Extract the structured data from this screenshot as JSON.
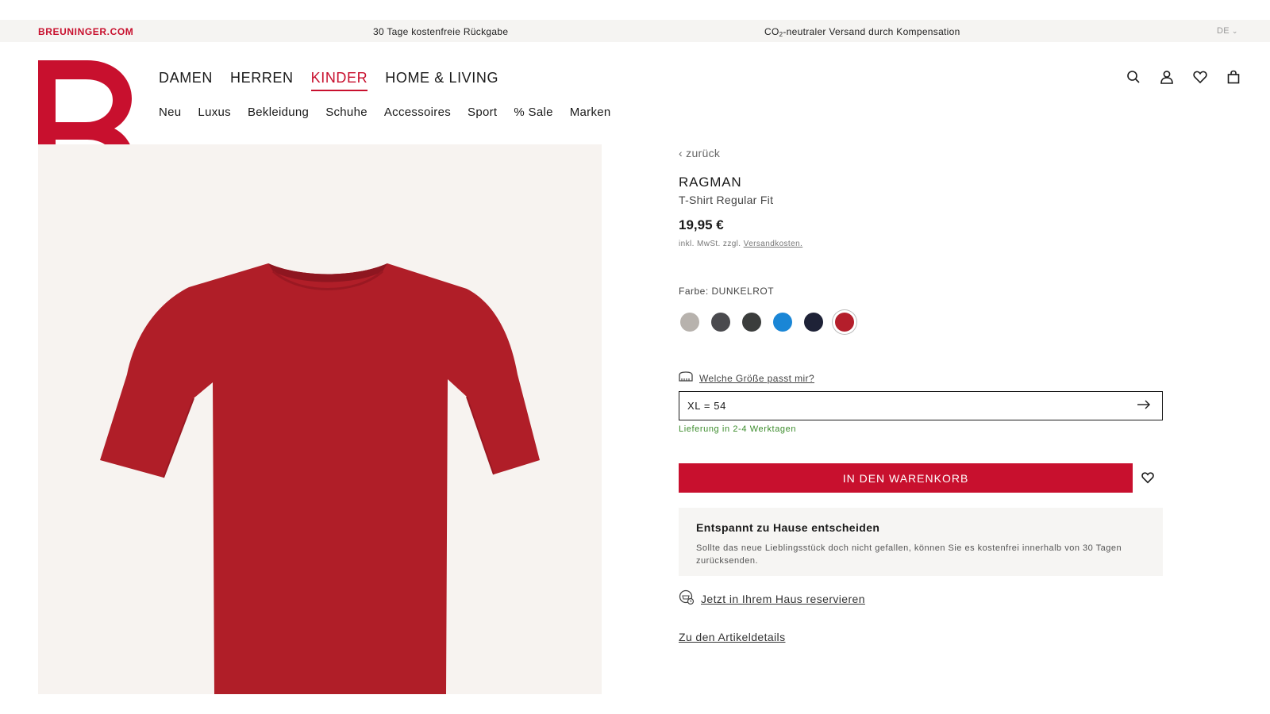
{
  "topbar": {
    "brand": "BREUNINGER.COM",
    "message_returns": "30 Tage kostenfreie Rückgabe",
    "message_shipping_pre": "CO",
    "message_shipping_sub": "2",
    "message_shipping_post": "-neutraler Versand durch Kompensation",
    "language": "DE"
  },
  "nav": {
    "main": [
      "DAMEN",
      "HERREN",
      "KINDER",
      "HOME & LIVING"
    ],
    "active": "KINDER",
    "sub": [
      "Neu",
      "Luxus",
      "Bekleidung",
      "Schuhe",
      "Accessoires",
      "Sport",
      "% Sale",
      "Marken"
    ]
  },
  "header_icons": [
    "search-icon",
    "user-icon",
    "heart-icon",
    "bag-icon"
  ],
  "product": {
    "back_label": "zurück",
    "brand": "RAGMAN",
    "name": "T-Shirt Regular Fit",
    "price": "19,95 €",
    "tax_note_prefix": "inkl. MwSt. zzgl.",
    "tax_note_link": "Versandkosten.",
    "color_label": "Farbe: DUNKELROT",
    "colors": [
      "#b7b2ad",
      "#4a4a4e",
      "#3b3d3c",
      "#1a86d6",
      "#1e2237",
      "#b41e2b"
    ],
    "selected_color_index": 5,
    "size_help_label": "Welche Größe passt mir?",
    "selected_size": "XL = 54",
    "delivery": "Lieferung in 2-4 Werktagen",
    "cart_button": "IN DEN WARENKORB",
    "info_title": "Entspannt zu Hause entscheiden",
    "info_text": "Sollte das neue Lieblingsstück doch nicht gefallen, können Sie es kostenfrei innerhalb von 30 Tagen zurücksenden.",
    "reserve_label": "Jetzt in Ihrem Haus reservieren",
    "details_label": "Zu den Artikeldetails"
  },
  "colors": {
    "brand_red": "#c8102e",
    "shirt_red": "#b01e28",
    "delivery_green": "#3c8c2c"
  }
}
